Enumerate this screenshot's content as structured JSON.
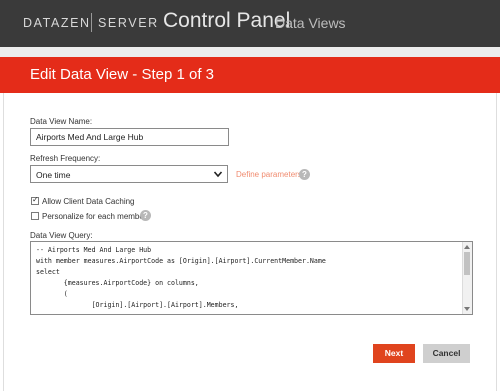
{
  "app": {
    "brand": "DATAZEN",
    "brand_product": "SERVER",
    "title": "Control Panel",
    "subtitle": "Data Views"
  },
  "dialog": {
    "title": "Edit Data View - Step 1 of 3",
    "name_label": "Data View Name:",
    "name_value": "Airports Med And Large Hub",
    "refresh_label": "Refresh Frequency:",
    "refresh_value": "One time",
    "define_params_link": "Define parameters...",
    "allow_caching_label": "Allow Client Data Caching",
    "allow_caching_checked": true,
    "personalize_label": "Personalize for each member",
    "personalize_checked": false,
    "query_label": "Data View Query:",
    "query_lines": [
      "-- Airports Med And Large Hub",
      "with member measures.AirportCode as [Origin].[Airport].CurrentMember.Name",
      "select",
      "       {measures.AirportCode} on columns,",
      "       (",
      "              [Origin].[Airport].[Airport].Members,"
    ],
    "next_label": "Next",
    "cancel_label": "Cancel"
  },
  "colors": {
    "top_bar": "#3a3a3a",
    "accent_red": "#e42c19",
    "next_button": "#e0441e",
    "link": "#f08b6f"
  }
}
